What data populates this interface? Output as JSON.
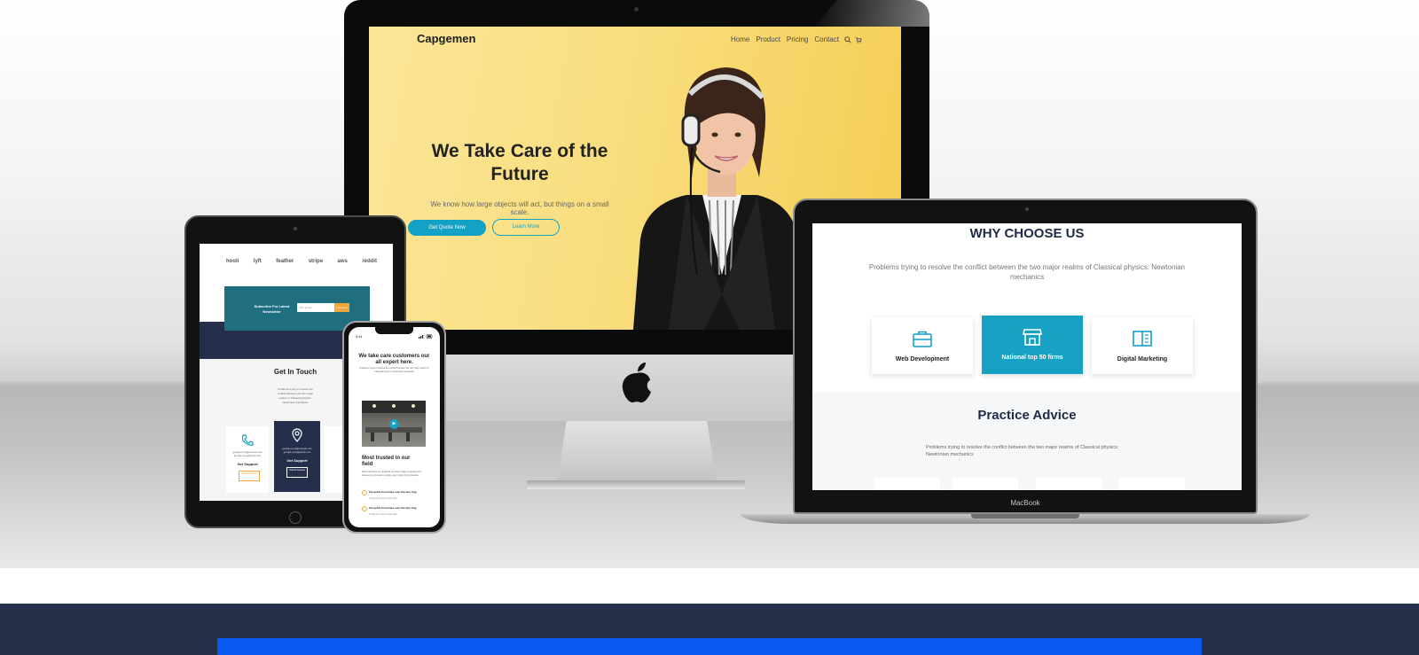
{
  "imac": {
    "logo": "Capgemen",
    "nav": [
      "Home",
      "Product",
      "Pricing",
      "Contact"
    ],
    "hero_title": "We Take Care of the Future",
    "hero_subtitle": "We know how large objects will act, but things on a small scale.",
    "primary_button": "Get Quote Now",
    "secondary_button": "Learn More"
  },
  "ipad": {
    "brands": [
      "hooli",
      "lyft",
      "feather",
      "stripe",
      "aws",
      "reddit"
    ],
    "newsletter_title": "Subscribe For Latest Newsletter",
    "newsletter_placeholder": "Your Email",
    "newsletter_button": "Subscribe",
    "get_in_touch_title": "Get In Touch",
    "get_in_touch_text": "Problems trying to resolve the conflict between the two major realms of Classical physics: Newtonian mechanics",
    "cards": [
      {
        "line1": "georgia.young@example.com",
        "line2": "georgia.young@ample.com",
        "title": "Get Support",
        "button": "Submit Request"
      },
      {
        "line1": "georgia.young@example.com",
        "line2": "georgia.young@ample.com",
        "title": "Get Support",
        "button": "Submit Request"
      }
    ]
  },
  "iphone": {
    "time": "9:41",
    "title": "We take care customers our all expert here.",
    "text": "Problems trying to resolve the conflict between the two major realms of Classical physics: Newtonian mechanics",
    "section_title": "Most trusted in our field",
    "section_text": "Most calendars are designed for teams. Slate is designed for freelancers who want a simple way to plan their schedule.",
    "features": [
      {
        "title": "the quick fox jumps over the lazy dog",
        "sub": "Things on a very small scale"
      },
      {
        "title": "the quick fox jumps over the lazy dog",
        "sub": "Things on a very small scale"
      }
    ]
  },
  "macbook": {
    "label": "MacBook",
    "why_title": "WHY CHOOSE US",
    "why_subtitle": "Problems trying to resolve the conflict between the two major realms of Classical physics: Newtonian mechanics",
    "services": [
      {
        "label": "Web Development",
        "icon": "briefcase-icon"
      },
      {
        "label": "National top 50 firms",
        "icon": "store-icon"
      },
      {
        "label": "Digital Marketing",
        "icon": "book-icon"
      }
    ],
    "practice_title": "Practice Advice",
    "practice_subtitle": "Problems trying to resolve the conflict between the two major realms of Classical physics: Newtonian mechanics"
  },
  "colors": {
    "accent": "#14a1c6",
    "navy": "#262f4a",
    "hero_yellow": "#f9de7f",
    "footer_blue": "#0a59f2"
  }
}
